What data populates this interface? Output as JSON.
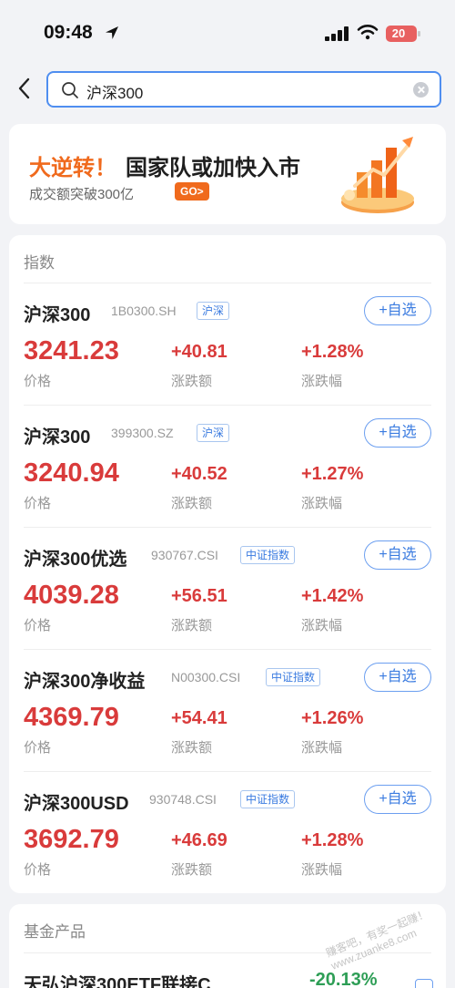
{
  "status_bar": {
    "time": "09:48",
    "battery": "20"
  },
  "search": {
    "query": "沪深300"
  },
  "banner": {
    "highlight": "大逆转！",
    "title": "国家队或加快入市",
    "subtitle": "成交额突破300亿",
    "go_label": "GO>"
  },
  "index_section": {
    "title": "指数",
    "add_label": "+自选",
    "price_label": "价格",
    "change_label": "涨跌额",
    "pct_label": "涨跌幅",
    "items": [
      {
        "name": "沪深300",
        "code": "1B0300.SH",
        "tag": "沪深",
        "price": "3241.23",
        "change": "+40.81",
        "pct": "+1.28%"
      },
      {
        "name": "沪深300",
        "code": "399300.SZ",
        "tag": "沪深",
        "price": "3240.94",
        "change": "+40.52",
        "pct": "+1.27%"
      },
      {
        "name": "沪深300优选",
        "code": "930767.CSI",
        "tag": "中证指数",
        "price": "4039.28",
        "change": "+56.51",
        "pct": "+1.42%"
      },
      {
        "name": "沪深300净收益",
        "code": "N00300.CSI",
        "tag": "中证指数",
        "price": "4369.79",
        "change": "+54.41",
        "pct": "+1.26%"
      },
      {
        "name": "沪深300USD",
        "code": "930748.CSI",
        "tag": "中证指数",
        "price": "3692.79",
        "change": "+46.69",
        "pct": "+1.28%"
      }
    ]
  },
  "fund_section": {
    "title": "基金产品",
    "items": [
      {
        "name": "天弘沪深300ETF联接C",
        "pct": "-20.13%"
      }
    ]
  },
  "watermark": "赚客吧，有奖一起赚！ www.zuanke8.com",
  "colors": {
    "up": "#d93b3b",
    "down": "#2e9e56",
    "accent": "#3a7be0",
    "banner_orange": "#f06a1d"
  }
}
